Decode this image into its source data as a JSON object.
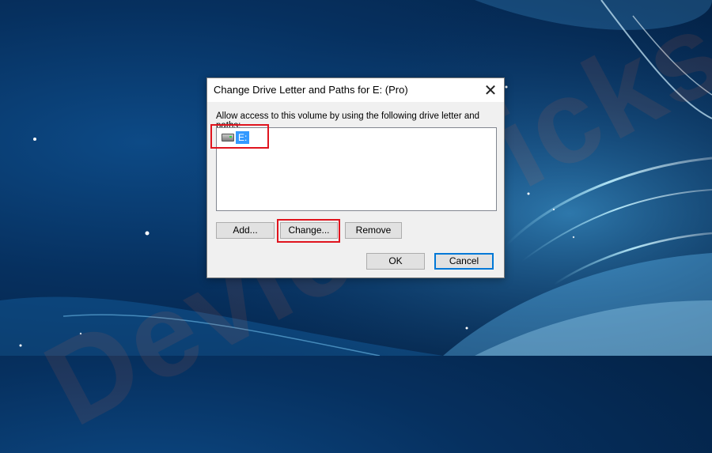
{
  "dialog": {
    "title": "Change Drive Letter and Paths for E: (Pro)",
    "close_glyph": "✕",
    "instruction": "Allow access to this volume by using the following drive letter and paths:",
    "list_items": [
      {
        "label": "E:",
        "icon": "drive-icon",
        "selected": true
      }
    ],
    "buttons": {
      "add": "Add...",
      "change": "Change...",
      "remove": "Remove",
      "ok": "OK",
      "cancel": "Cancel"
    }
  },
  "watermark": {
    "text": "DeviceTricks"
  },
  "colors": {
    "highlight": "#e0141e",
    "selection": "#3399ff",
    "focus_border": "#0078d7"
  }
}
